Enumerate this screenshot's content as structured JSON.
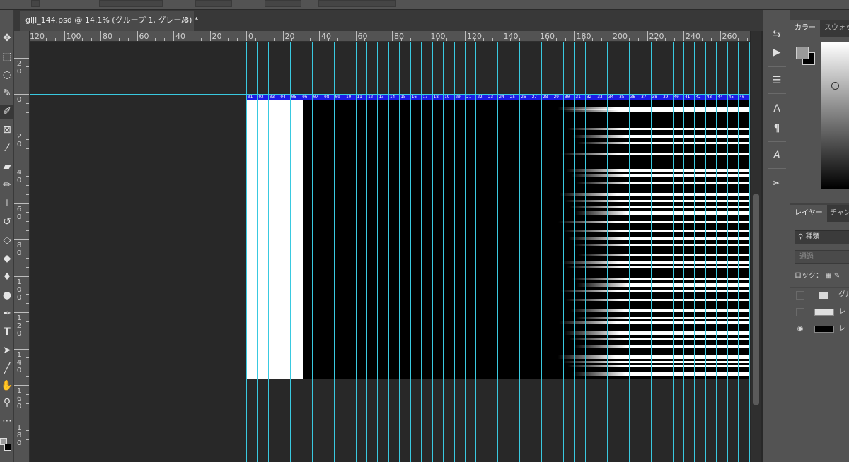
{
  "document": {
    "tab_title": "giji_144.psd @ 14.1% (グループ 1, グレー/8) *",
    "close_glyph": "×"
  },
  "rulers": {
    "h_labels": [
      "120",
      "100",
      "80",
      "60",
      "40",
      "20",
      "0",
      "20",
      "40",
      "60",
      "80",
      "100",
      "120",
      "140",
      "160",
      "180",
      "200",
      "220",
      "240",
      "260"
    ],
    "v_labels": [
      [
        "2",
        "0"
      ],
      [
        "0"
      ],
      [
        "2",
        "0"
      ],
      [
        "4",
        "0"
      ],
      [
        "6",
        "0"
      ],
      [
        "8",
        "0"
      ],
      [
        "1",
        "0",
        "0"
      ],
      [
        "1",
        "2",
        "0"
      ],
      [
        "1",
        "4",
        "0"
      ],
      [
        "1",
        "6",
        "0"
      ],
      [
        "1",
        "8",
        "0"
      ]
    ]
  },
  "artboard": {
    "column_numbers": [
      "01",
      "02",
      "03",
      "04",
      "05",
      "06",
      "07",
      "08",
      "09",
      "10",
      "11",
      "12",
      "13",
      "14",
      "15",
      "16",
      "17",
      "18",
      "19",
      "20",
      "21",
      "22",
      "23",
      "24",
      "25",
      "26",
      "27",
      "28",
      "29",
      "30",
      "31",
      "32",
      "33",
      "34",
      "35",
      "36",
      "37",
      "38",
      "39",
      "40",
      "41",
      "42",
      "43",
      "44",
      "45",
      "46"
    ],
    "colors": {
      "guide": "#39c9e0",
      "header": "#1c1ce6",
      "background": "#000000",
      "white_block": "#ffffff"
    }
  },
  "toolbar": {
    "tools": [
      "move-tool",
      "marquee-tool",
      "lasso-tool",
      "quick-select-tool",
      "crop-tool",
      "frame-tool",
      "eyedropper-tool",
      "healing-tool",
      "brush-tool",
      "stamp-tool",
      "history-brush-tool",
      "eraser-tool",
      "paint-bucket-tool",
      "blur-tool",
      "dodge-tool",
      "pen-tool",
      "type-tool",
      "path-select-tool",
      "line-tool",
      "hand-tool",
      "zoom-tool",
      "more-tools"
    ]
  },
  "panels": {
    "color_tab": "カラー",
    "swatches_tab": "スウォッチ",
    "layers_tab": "レイヤー",
    "channels_tab": "チャンネル",
    "search_label": "種類",
    "blend_mode": "通過",
    "lock_label": "ロック：",
    "layers": [
      {
        "name": "グル",
        "visible": false,
        "type": "group"
      },
      {
        "name": "レ",
        "visible": false,
        "type": "layer"
      },
      {
        "name": "レ",
        "visible": true,
        "type": "layer"
      }
    ],
    "collapse_glyph": "«"
  }
}
